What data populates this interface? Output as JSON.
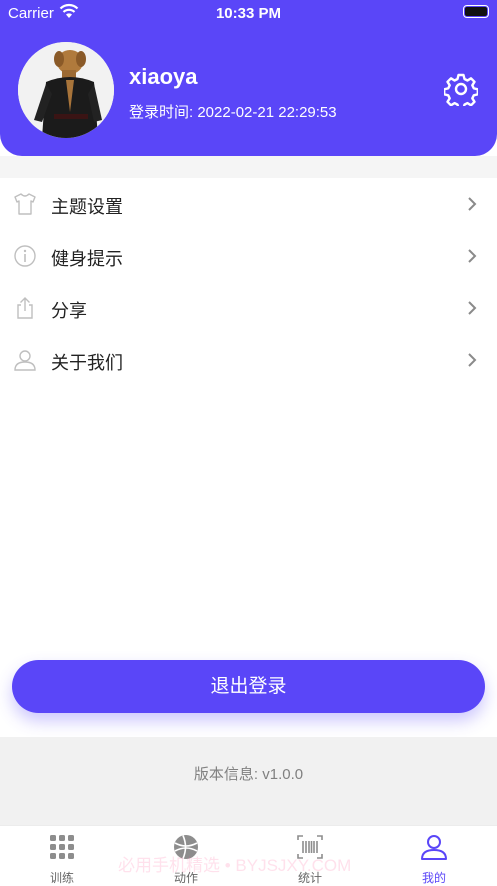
{
  "status_bar": {
    "carrier": "Carrier",
    "time": "10:33 PM"
  },
  "profile": {
    "username": "xiaoya",
    "login_time": "登录时间: 2022-02-21 22:29:53"
  },
  "menu": [
    {
      "label": "主题设置",
      "icon": "tshirt-icon"
    },
    {
      "label": "健身提示",
      "icon": "info-icon"
    },
    {
      "label": "分享",
      "icon": "share-icon"
    },
    {
      "label": "关于我们",
      "icon": "person-icon"
    }
  ],
  "logout_label": "退出登录",
  "version": "版本信息: v1.0.0",
  "tabs": [
    {
      "label": "训练",
      "icon": "grid-icon"
    },
    {
      "label": "动作",
      "icon": "ball-icon"
    },
    {
      "label": "统计",
      "icon": "barcode-icon"
    },
    {
      "label": "我的",
      "icon": "user-icon",
      "active": true
    }
  ],
  "watermark": "必用手机精选 • BYJSJXY.COM",
  "colors": {
    "accent": "#5a46f8",
    "background": "#ffffff",
    "version_bg": "#f1f1f1"
  }
}
